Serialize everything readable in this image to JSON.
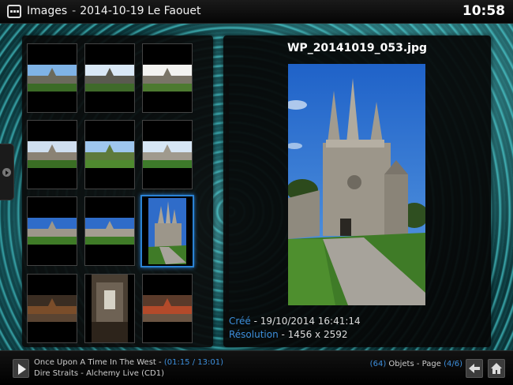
{
  "header": {
    "section": "Images",
    "separator": "-",
    "folder": "2014-10-19 Le Faouet",
    "clock": "10:58"
  },
  "thumbnails": [
    {
      "icon": "landscape-thumbnail"
    },
    {
      "icon": "landscape-thumbnail"
    },
    {
      "icon": "landscape-thumbnail"
    },
    {
      "icon": "landscape-thumbnail"
    },
    {
      "icon": "landscape-thumbnail"
    },
    {
      "icon": "landscape-thumbnail"
    },
    {
      "icon": "landscape-thumbnail"
    },
    {
      "icon": "landscape-thumbnail"
    },
    {
      "icon": "portrait-thumbnail",
      "selected": true
    },
    {
      "icon": "landscape-thumbnail"
    },
    {
      "icon": "portrait-thumbnail"
    },
    {
      "icon": "landscape-thumbnail"
    }
  ],
  "detail": {
    "filename": "WP_20141019_053.jpg",
    "created_label": "Créé",
    "created_value": "19/10/2014 16:41:14",
    "resolution_label": "Résolution",
    "resolution_value": "1456 x 2592",
    "meta_sep": " - "
  },
  "player": {
    "track_title": "Once Upon A Time In The West",
    "time_elapsed": "01:15",
    "time_total": "13:01",
    "artist_album": "Dire Straits - Alchemy Live (CD1)"
  },
  "pager": {
    "object_count": "64",
    "objects_label": "Objets",
    "page_label": "Page",
    "page_current": "4",
    "page_total": "6"
  },
  "colors": {
    "accent": "#3d8fdc",
    "selection": "#2a82d4",
    "panel": "#0a0a0a"
  }
}
